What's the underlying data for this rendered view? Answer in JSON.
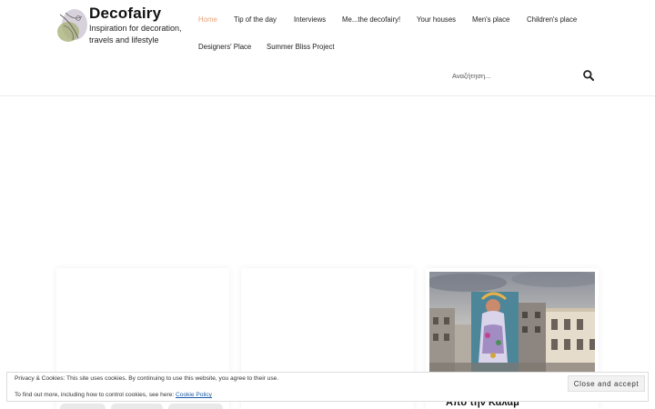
{
  "site": {
    "name": "Decofairy",
    "tagline": "Inspiration for decoration, travels and lifestyle",
    "accent_color": "#e8a27a"
  },
  "nav": {
    "items": [
      {
        "label": "Home",
        "active": true
      },
      {
        "label": "Tip of the day",
        "active": false
      },
      {
        "label": "Interviews",
        "active": false
      },
      {
        "label": "Me...the decofairy!",
        "active": false
      },
      {
        "label": "Your houses",
        "active": false
      },
      {
        "label": "Men's place",
        "active": false
      },
      {
        "label": "Children's place",
        "active": false
      },
      {
        "label": "Designers' Place",
        "active": false
      },
      {
        "label": "Summer Bliss Project",
        "active": false
      }
    ]
  },
  "search": {
    "placeholder": "Αναζήτηση...",
    "icon": "search-icon"
  },
  "cards": [
    {
      "title": ""
    },
    {
      "title": ""
    },
    {
      "title": "Από την Καλαμ"
    }
  ],
  "cookie_banner": {
    "line1": "Privacy & Cookies: This site uses cookies. By continuing to use this website, you agree to their use.",
    "line2_prefix": "To find out more, including how to control cookies, see here: ",
    "link_label": "Cookie Policy",
    "button_label": "Close and accept"
  }
}
